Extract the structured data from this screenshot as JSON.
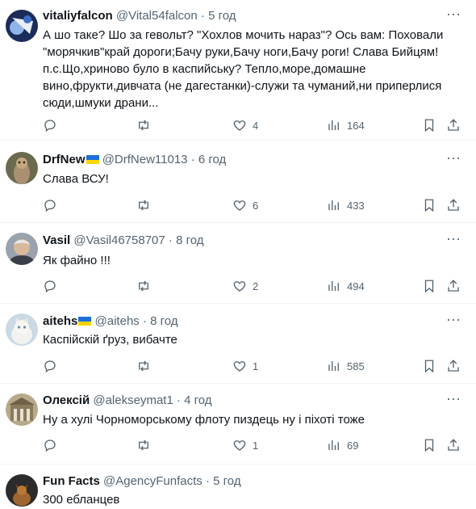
{
  "posts": [
    {
      "name": "vitaliyfalcon",
      "flag": false,
      "handle": "@Vital54falcon",
      "time": "5 год",
      "text": "А шо таке? Шо за гевольт? \"Хохлов мочить нараз\"? Ось вам: Поховали \"морячкив\"край дороги;Бачу руки,Бачу ноги,Бачу роги! Слава Бийцям! п.с.Що,хриново було в каспийську? Тепло,море,домашне вино,фрукти,дивчата (не дагестанки)-служи та чуманий,ни приперлися сюди,шмуки драни...",
      "replies": "",
      "reposts": "",
      "likes": "4",
      "views": "164"
    },
    {
      "name": "DrfNew",
      "flag": true,
      "handle": "@DrfNew11013",
      "time": "6 год",
      "text": "Слава ВСУ!",
      "replies": "",
      "reposts": "",
      "likes": "6",
      "views": "433"
    },
    {
      "name": "Vasil",
      "flag": false,
      "handle": "@Vasil46758707",
      "time": "8 год",
      "text": "Як файно !!!",
      "replies": "",
      "reposts": "",
      "likes": "2",
      "views": "494"
    },
    {
      "name": "aitehs",
      "flag": true,
      "handle": "@aitehs",
      "time": "8 год",
      "text": "Каспійскій ґруз, вибачте",
      "replies": "",
      "reposts": "",
      "likes": "1",
      "views": "585"
    },
    {
      "name": "Олексій",
      "flag": false,
      "handle": "@alekseymat1",
      "time": "4 год",
      "text": "Ну а хулі Чорноморському флоту пиздець ну і піхоті тоже",
      "replies": "",
      "reposts": "",
      "likes": "1",
      "views": "69"
    },
    {
      "name": "Fun Facts",
      "flag": false,
      "handle": "@AgencyFunfacts",
      "time": "5 год",
      "text": "300 ебланцев",
      "replies": "",
      "reposts": "",
      "likes": "",
      "views": ""
    }
  ],
  "separator": "·",
  "icons": {
    "reply": "reply-icon",
    "repost": "repost-icon",
    "like": "heart-icon",
    "views": "views-icon",
    "bookmark": "bookmark-icon",
    "share": "share-icon",
    "more": "more-icon"
  },
  "colors": {
    "text": "#0f1419",
    "secondary": "#536471",
    "divider": "#eff3f4",
    "flag_blue": "#1d6fd9",
    "flag_yellow": "#ffd500"
  }
}
